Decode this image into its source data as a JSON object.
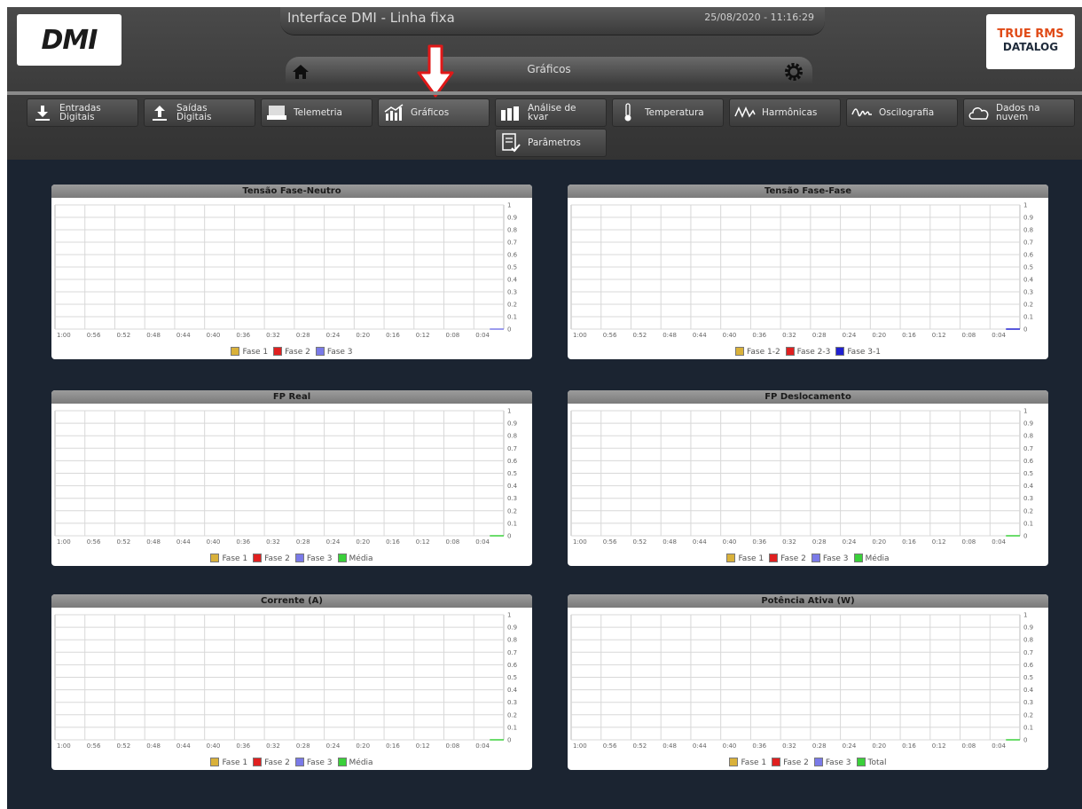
{
  "header": {
    "logo_left": "DMI",
    "logo_right_line1": "TRUE RMS",
    "logo_right_line2": "DATALOG",
    "app_title": "Interface DMI - Linha fixa",
    "datetime": "25/08/2020 - 11:16:29",
    "page_title": "Gráficos"
  },
  "tabs": [
    {
      "label": "Entradas\nDigitais",
      "icon": "download-icon"
    },
    {
      "label": "Saídas\nDigitais",
      "icon": "upload-icon"
    },
    {
      "label": "Telemetria",
      "icon": "keyboard-icon"
    },
    {
      "label": "Gráficos",
      "icon": "bar-chart-icon"
    },
    {
      "label": "Análise de\nkvar",
      "icon": "capacitor-icon"
    },
    {
      "label": "Temperatura",
      "icon": "thermometer-icon"
    },
    {
      "label": "Harmônicas",
      "icon": "waveform-icon"
    },
    {
      "label": "Oscilografia",
      "icon": "oscillograph-icon"
    },
    {
      "label": "Dados na\nnuvem",
      "icon": "cloud-icon"
    },
    {
      "label": "Parâmetros",
      "icon": "checklist-icon"
    }
  ],
  "colors": {
    "fase1": "#d9b13a",
    "fase2": "#e02020",
    "fase3": "#7a7ae8",
    "fase3_1": "#2020d0",
    "media": "#3ad03a",
    "background": "#1b2431"
  },
  "chart_data": [
    {
      "type": "line",
      "title": "Tensão Fase-Neutro",
      "x_ticks": [
        "1:00",
        "0:56",
        "0:52",
        "0:48",
        "0:44",
        "0:40",
        "0:36",
        "0:32",
        "0:28",
        "0:24",
        "0:20",
        "0:16",
        "0:12",
        "0:08",
        "0:04"
      ],
      "y_ticks": [
        "1",
        "0.9",
        "0.8",
        "0.7",
        "0.6",
        "0.5",
        "0.4",
        "0.3",
        "0.2",
        "0.1",
        "0"
      ],
      "ylim": [
        0,
        1
      ],
      "grid": true,
      "legend": [
        {
          "name": "Fase 1",
          "color": "#d9b13a"
        },
        {
          "name": "Fase 2",
          "color": "#e02020"
        },
        {
          "name": "Fase 3",
          "color": "#7a7ae8"
        }
      ],
      "series": [
        {
          "name": "Fase 3",
          "color": "#7a7ae8",
          "values": [
            0,
            0
          ]
        }
      ]
    },
    {
      "type": "line",
      "title": "Tensão Fase-Fase",
      "x_ticks": [
        "1:00",
        "0:56",
        "0:52",
        "0:48",
        "0:44",
        "0:40",
        "0:36",
        "0:32",
        "0:28",
        "0:24",
        "0:20",
        "0:16",
        "0:12",
        "0:08",
        "0:04"
      ],
      "y_ticks": [
        "1",
        "0.9",
        "0.8",
        "0.7",
        "0.6",
        "0.5",
        "0.4",
        "0.3",
        "0.2",
        "0.1",
        "0"
      ],
      "ylim": [
        0,
        1
      ],
      "grid": true,
      "legend": [
        {
          "name": "Fase 1-2",
          "color": "#d9b13a"
        },
        {
          "name": "Fase 2-3",
          "color": "#e02020"
        },
        {
          "name": "Fase 3-1",
          "color": "#2020d0"
        }
      ],
      "series": [
        {
          "name": "Fase 3-1",
          "color": "#2020d0",
          "values": [
            0,
            0
          ]
        }
      ]
    },
    {
      "type": "line",
      "title": "FP Real",
      "x_ticks": [
        "1:00",
        "0:56",
        "0:52",
        "0:48",
        "0:44",
        "0:40",
        "0:36",
        "0:32",
        "0:28",
        "0:24",
        "0:20",
        "0:16",
        "0:12",
        "0:08",
        "0:04"
      ],
      "y_ticks": [
        "1",
        "0.9",
        "0.8",
        "0.7",
        "0.6",
        "0.5",
        "0.4",
        "0.3",
        "0.2",
        "0.1",
        "0"
      ],
      "ylim": [
        0,
        1
      ],
      "grid": true,
      "legend": [
        {
          "name": "Fase 1",
          "color": "#d9b13a"
        },
        {
          "name": "Fase 2",
          "color": "#e02020"
        },
        {
          "name": "Fase 3",
          "color": "#7a7ae8"
        },
        {
          "name": "Média",
          "color": "#3ad03a"
        }
      ],
      "series": [
        {
          "name": "Média",
          "color": "#3ad03a",
          "values": [
            0,
            0
          ]
        }
      ]
    },
    {
      "type": "line",
      "title": "FP Deslocamento",
      "x_ticks": [
        "1:00",
        "0:56",
        "0:52",
        "0:48",
        "0:44",
        "0:40",
        "0:36",
        "0:32",
        "0:28",
        "0:24",
        "0:20",
        "0:16",
        "0:12",
        "0:08",
        "0:04"
      ],
      "y_ticks": [
        "1",
        "0.9",
        "0.8",
        "0.7",
        "0.6",
        "0.5",
        "0.4",
        "0.3",
        "0.2",
        "0.1",
        "0"
      ],
      "ylim": [
        0,
        1
      ],
      "grid": true,
      "legend": [
        {
          "name": "Fase 1",
          "color": "#d9b13a"
        },
        {
          "name": "Fase 2",
          "color": "#e02020"
        },
        {
          "name": "Fase 3",
          "color": "#7a7ae8"
        },
        {
          "name": "Média",
          "color": "#3ad03a"
        }
      ],
      "series": [
        {
          "name": "Média",
          "color": "#3ad03a",
          "values": [
            0,
            0
          ]
        }
      ]
    },
    {
      "type": "line",
      "title": "Corrente (A)",
      "x_ticks": [
        "1:00",
        "0:56",
        "0:52",
        "0:48",
        "0:44",
        "0:40",
        "0:36",
        "0:32",
        "0:28",
        "0:24",
        "0:20",
        "0:16",
        "0:12",
        "0:08",
        "0:04"
      ],
      "y_ticks": [
        "1",
        "0.9",
        "0.8",
        "0.7",
        "0.6",
        "0.5",
        "0.4",
        "0.3",
        "0.2",
        "0.1",
        "0"
      ],
      "ylim": [
        0,
        1
      ],
      "grid": true,
      "legend": [
        {
          "name": "Fase 1",
          "color": "#d9b13a"
        },
        {
          "name": "Fase 2",
          "color": "#e02020"
        },
        {
          "name": "Fase 3",
          "color": "#7a7ae8"
        },
        {
          "name": "Média",
          "color": "#3ad03a"
        }
      ],
      "series": [
        {
          "name": "Média",
          "color": "#3ad03a",
          "values": [
            0,
            0
          ]
        }
      ]
    },
    {
      "type": "line",
      "title": "Potência Ativa (W)",
      "x_ticks": [
        "1:00",
        "0:56",
        "0:52",
        "0:48",
        "0:44",
        "0:40",
        "0:36",
        "0:32",
        "0:28",
        "0:24",
        "0:20",
        "0:16",
        "0:12",
        "0:08",
        "0:04"
      ],
      "y_ticks": [
        "1",
        "0.9",
        "0.8",
        "0.7",
        "0.6",
        "0.5",
        "0.4",
        "0.3",
        "0.2",
        "0.1",
        "0"
      ],
      "ylim": [
        0,
        1
      ],
      "grid": true,
      "legend": [
        {
          "name": "Fase 1",
          "color": "#d9b13a"
        },
        {
          "name": "Fase 2",
          "color": "#e02020"
        },
        {
          "name": "Fase 3",
          "color": "#7a7ae8"
        },
        {
          "name": "Total",
          "color": "#3ad03a"
        }
      ],
      "series": [
        {
          "name": "Total",
          "color": "#3ad03a",
          "values": [
            0,
            0
          ]
        }
      ]
    }
  ]
}
